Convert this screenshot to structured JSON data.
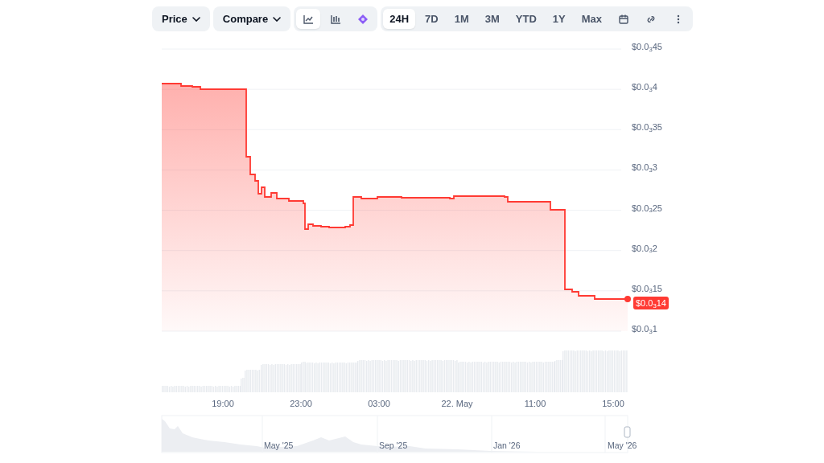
{
  "toolbar": {
    "dropdowns": [
      {
        "label": "Price"
      },
      {
        "label": "Compare"
      }
    ],
    "chart_types": [
      {
        "kind": "line",
        "selected": true
      },
      {
        "kind": "bars",
        "selected": false
      },
      {
        "kind": "tradingview",
        "selected": false
      }
    ],
    "ranges": [
      {
        "label": "24H",
        "selected": true
      },
      {
        "label": "7D",
        "selected": false
      },
      {
        "label": "1M",
        "selected": false
      },
      {
        "label": "3M",
        "selected": false
      },
      {
        "label": "YTD",
        "selected": false
      },
      {
        "label": "1Y",
        "selected": false
      },
      {
        "label": "Max",
        "selected": false
      }
    ]
  },
  "chart": {
    "y_labels": [
      "$0.0$_{3}$45",
      "$0.0$_{3}$4",
      "$0.0$_{3}$35",
      "$0.0$_{3}$3",
      "$0.0$_{3}$25",
      "$0.0$_{3}$2",
      "$0.0$_{3}$15",
      "$0.0$_{3}$1"
    ],
    "x_labels": [
      "19:00",
      "23:00",
      "03:00",
      "22. May",
      "11:00",
      "15:00"
    ],
    "current_price": "$0.0$_{3}$14"
  },
  "navigator": {
    "labels": [
      "May '25",
      "Sep '25",
      "Jan '26",
      "May '26"
    ]
  }
}
